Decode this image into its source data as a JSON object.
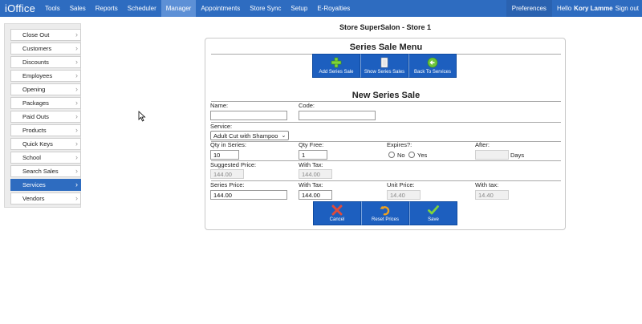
{
  "nav": {
    "brand": "iOffice",
    "items": [
      "Tools",
      "Sales",
      "Reports",
      "Scheduler",
      "Manager",
      "Appointments",
      "Store Sync",
      "Setup",
      "E-Royalties"
    ],
    "active": "Manager",
    "preferences": "Preferences",
    "hello": "Hello",
    "user": "Kory Lamme",
    "signout": "Sign out"
  },
  "sidebar": {
    "items": [
      "Close Out",
      "Customers",
      "Discounts",
      "Employees",
      "Opening",
      "Packages",
      "Paid Outs",
      "Products",
      "Quick Keys",
      "School",
      "Search Sales",
      "Services",
      "Vendors"
    ],
    "active": "Services"
  },
  "page": {
    "store_title": "Store SuperSalon - Store 1",
    "menu_title": "Series Sale Menu",
    "menu_buttons": [
      "Add Series Sale",
      "Show Series Sales",
      "Back To Services"
    ],
    "form_title": "New Series Sale"
  },
  "form": {
    "name_label": "Name:",
    "name_value": "",
    "code_label": "Code:",
    "code_value": "",
    "service_label": "Service:",
    "service_value": "Adult Cut with Shampoo",
    "qty_series_label": "Qty in Series:",
    "qty_series_value": "10",
    "qty_free_label": "Qty Free:",
    "qty_free_value": "1",
    "expires_label": "Expires?:",
    "expires_no": "No",
    "expires_yes": "Yes",
    "after_label": "After:",
    "after_value": "",
    "after_unit": "Days",
    "suggested_label": "Suggested Price:",
    "suggested_value": "144.00",
    "with_tax_label": "With Tax:",
    "suggested_tax_value": "144.00",
    "series_price_label": "Series Price:",
    "series_price_value": "144.00",
    "series_tax_label": "With Tax:",
    "series_tax_value": "144.00",
    "unit_price_label": "Unit Price:",
    "unit_price_value": "14.40",
    "unit_tax_label": "With tax:",
    "unit_tax_value": "14.40"
  },
  "actions": [
    "Cancel",
    "Reset Prices",
    "Save"
  ],
  "colors": {
    "nav": "#2e6cc0",
    "button": "#1d5fbf",
    "active_nav": "#5d90d6"
  }
}
